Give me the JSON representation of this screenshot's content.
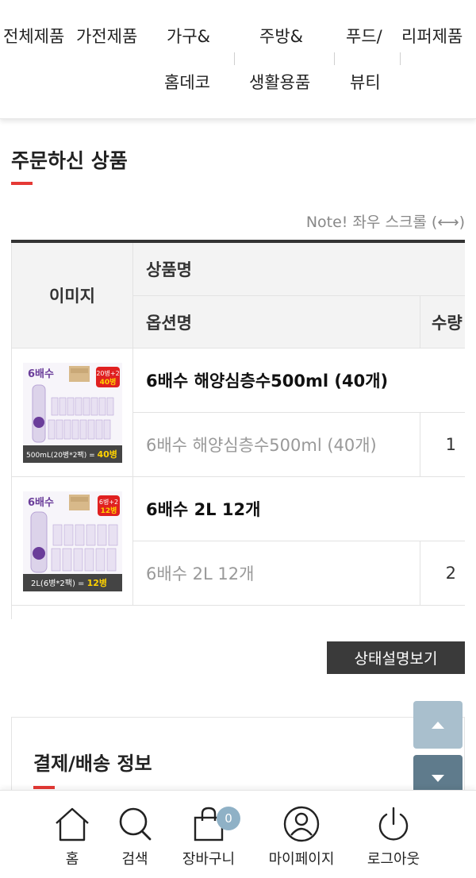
{
  "category_nav": {
    "items": [
      {
        "line1": "전체제품",
        "line2": ""
      },
      {
        "line1": "가전제품",
        "line2": ""
      },
      {
        "line1": "가구&",
        "line2": "홈데코"
      },
      {
        "line1": "주방&",
        "line2": "생활용품"
      },
      {
        "line1": "푸드/",
        "line2": "뷰티"
      },
      {
        "line1": "리퍼제품",
        "line2": ""
      }
    ]
  },
  "order_section": {
    "title": "주문하신 상품",
    "scroll_note": "Note! 좌우 스크롤 (⟷)"
  },
  "table": {
    "headers": {
      "image": "이미지",
      "product_name": "상품명",
      "option_name": "옵션명",
      "quantity": "수량"
    },
    "rows": [
      {
        "name": "6배수 해양심층수500ml (40개)",
        "option": "6배수 해양심층수500ml (40개)",
        "qty": "1",
        "thumb": {
          "brand": "6배수",
          "promo_top": "20병+2",
          "promo_bottom": "40병",
          "caption": "500mL(20병*2팩) = ",
          "caption_highlight": "40병"
        }
      },
      {
        "name": "6배수 2L 12개",
        "option": "6배수 2L 12개",
        "qty": "2",
        "thumb": {
          "brand": "6배수",
          "promo_top": "6병+2",
          "promo_bottom": "12병",
          "caption": "2L(6병*2팩) = ",
          "caption_highlight": "12병"
        }
      }
    ]
  },
  "status_button": {
    "label": "상태설명보기"
  },
  "payment_section": {
    "title": "결제/배송 정보"
  },
  "bottom_nav": {
    "items": [
      {
        "label": "홈",
        "icon": "home-icon"
      },
      {
        "label": "검색",
        "icon": "search-icon"
      },
      {
        "label": "장바구니",
        "icon": "shopping-bag-icon",
        "badge": "0"
      },
      {
        "label": "마이페이지",
        "icon": "user-icon"
      },
      {
        "label": "로그아웃",
        "icon": "power-icon"
      }
    ]
  },
  "colors": {
    "accent_red": "#e53935",
    "dark_button": "#3a3a3a",
    "scroll_up": "#a9bfcd",
    "scroll_down": "#5f7b8c",
    "badge": "#8fb1c6",
    "product_purple": "#6a3d9a",
    "promo_red": "#e02020",
    "promo_yellow": "#ffd200"
  }
}
